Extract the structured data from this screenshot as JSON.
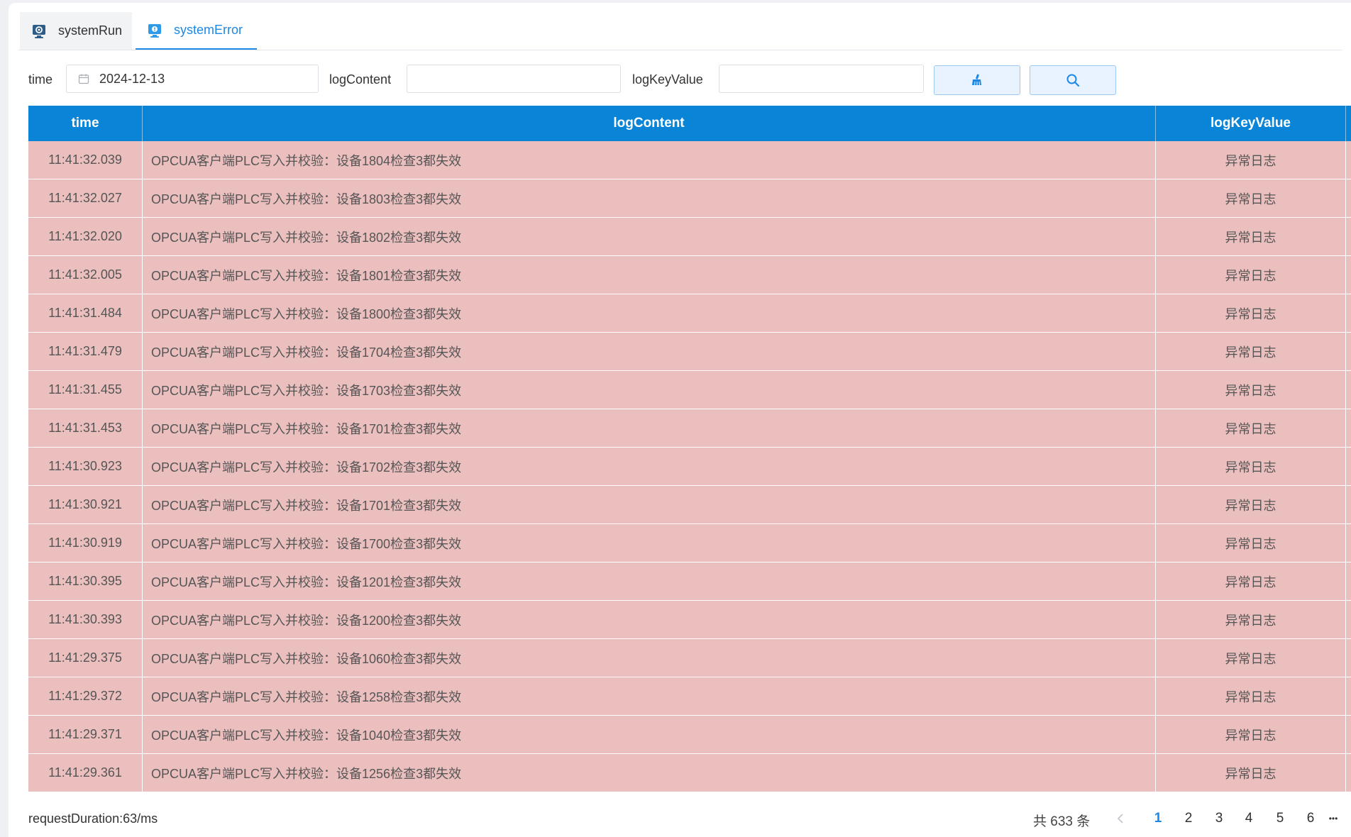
{
  "tabs": [
    {
      "label": "systemRun",
      "icon": "gear-monitor-icon",
      "active": false
    },
    {
      "label": "systemError",
      "icon": "alert-monitor-icon",
      "active": true
    }
  ],
  "search": {
    "time_label": "time",
    "time_value": "2024-12-13",
    "log_content_label": "logContent",
    "log_content_value": "",
    "log_key_value_label": "logKeyValue",
    "log_key_value_value": ""
  },
  "buttons": {
    "clear_icon": "broom-icon",
    "search_icon": "search-icon"
  },
  "table": {
    "headers": [
      "time",
      "logContent",
      "logKeyValue"
    ],
    "rows": [
      {
        "time": "11:41:32.039",
        "logContent": "OPCUA客户端PLC写入并校验：设备1804检查3都失效",
        "logKeyValue": "异常日志"
      },
      {
        "time": "11:41:32.027",
        "logContent": "OPCUA客户端PLC写入并校验：设备1803检查3都失效",
        "logKeyValue": "异常日志"
      },
      {
        "time": "11:41:32.020",
        "logContent": "OPCUA客户端PLC写入并校验：设备1802检查3都失效",
        "logKeyValue": "异常日志"
      },
      {
        "time": "11:41:32.005",
        "logContent": "OPCUA客户端PLC写入并校验：设备1801检查3都失效",
        "logKeyValue": "异常日志"
      },
      {
        "time": "11:41:31.484",
        "logContent": "OPCUA客户端PLC写入并校验：设备1800检查3都失效",
        "logKeyValue": "异常日志"
      },
      {
        "time": "11:41:31.479",
        "logContent": "OPCUA客户端PLC写入并校验：设备1704检查3都失效",
        "logKeyValue": "异常日志"
      },
      {
        "time": "11:41:31.455",
        "logContent": "OPCUA客户端PLC写入并校验：设备1703检查3都失效",
        "logKeyValue": "异常日志"
      },
      {
        "time": "11:41:31.453",
        "logContent": "OPCUA客户端PLC写入并校验：设备1701检查3都失效",
        "logKeyValue": "异常日志"
      },
      {
        "time": "11:41:30.923",
        "logContent": "OPCUA客户端PLC写入并校验：设备1702检查3都失效",
        "logKeyValue": "异常日志"
      },
      {
        "time": "11:41:30.921",
        "logContent": "OPCUA客户端PLC写入并校验：设备1701检查3都失效",
        "logKeyValue": "异常日志"
      },
      {
        "time": "11:41:30.919",
        "logContent": "OPCUA客户端PLC写入并校验：设备1700检查3都失效",
        "logKeyValue": "异常日志"
      },
      {
        "time": "11:41:30.395",
        "logContent": "OPCUA客户端PLC写入并校验：设备1201检查3都失效",
        "logKeyValue": "异常日志"
      },
      {
        "time": "11:41:30.393",
        "logContent": "OPCUA客户端PLC写入并校验：设备1200检查3都失效",
        "logKeyValue": "异常日志"
      },
      {
        "time": "11:41:29.375",
        "logContent": "OPCUA客户端PLC写入并校验：设备1060检查3都失效",
        "logKeyValue": "异常日志"
      },
      {
        "time": "11:41:29.372",
        "logContent": "OPCUA客户端PLC写入并校验：设备1258检查3都失效",
        "logKeyValue": "异常日志"
      },
      {
        "time": "11:41:29.371",
        "logContent": "OPCUA客户端PLC写入并校验：设备1040检查3都失效",
        "logKeyValue": "异常日志"
      },
      {
        "time": "11:41:29.361",
        "logContent": "OPCUA客户端PLC写入并校验：设备1256检查3都失效",
        "logKeyValue": "异常日志"
      }
    ]
  },
  "footer": {
    "request_duration": "requestDuration:63/ms",
    "total": "共 633 条",
    "pages": [
      "1",
      "2",
      "3",
      "4",
      "5",
      "6"
    ],
    "current_page": "1",
    "more": "•••"
  },
  "colors": {
    "accent": "#1e88e5",
    "header_bg": "#0a84d6",
    "error_row_bg": "#ecbfbf"
  }
}
